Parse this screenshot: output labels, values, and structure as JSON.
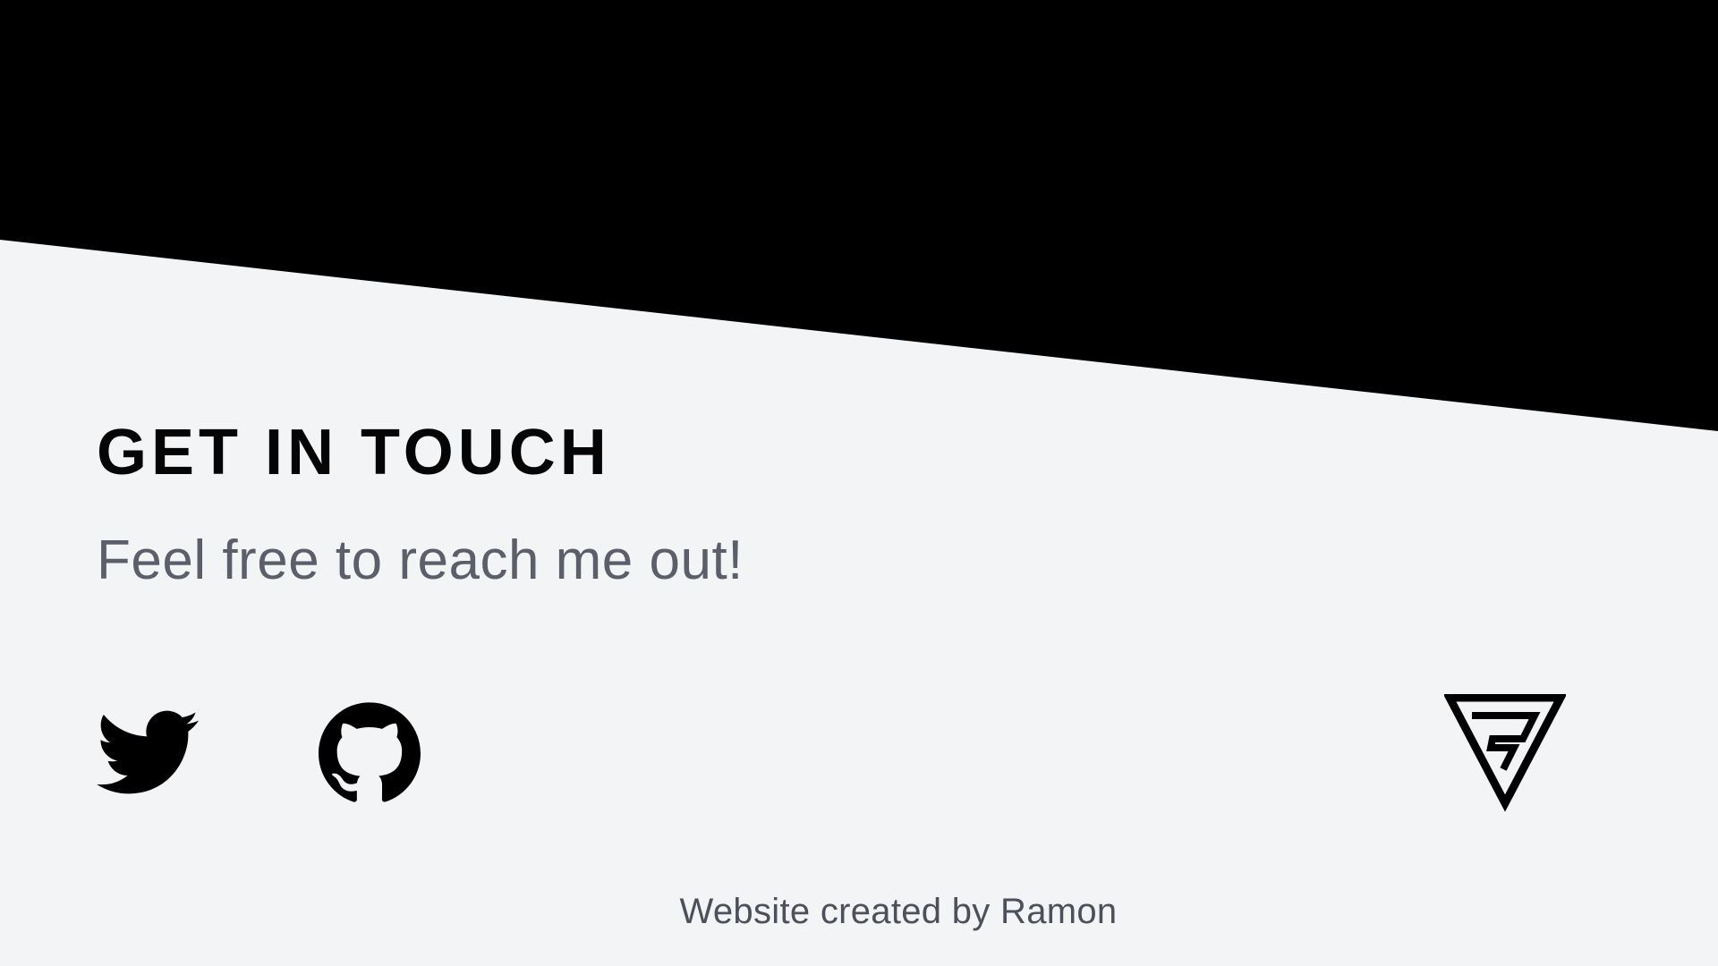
{
  "contact": {
    "heading": "GET IN TOUCH",
    "subheading": "Feel free to reach me out!"
  },
  "social": {
    "links": [
      {
        "icon": "twitter-icon",
        "label": "Twitter"
      },
      {
        "icon": "github-icon",
        "label": "GitHub"
      }
    ]
  },
  "brand": {
    "logo_icon": "triangle-r-logo"
  },
  "footer": {
    "credit": "Website created by Ramon"
  },
  "colors": {
    "background": "#f3f4f6",
    "top_band": "#000000",
    "heading": "#050505",
    "subheading": "#5c5e6a",
    "footer_text": "#4d4f5a"
  }
}
